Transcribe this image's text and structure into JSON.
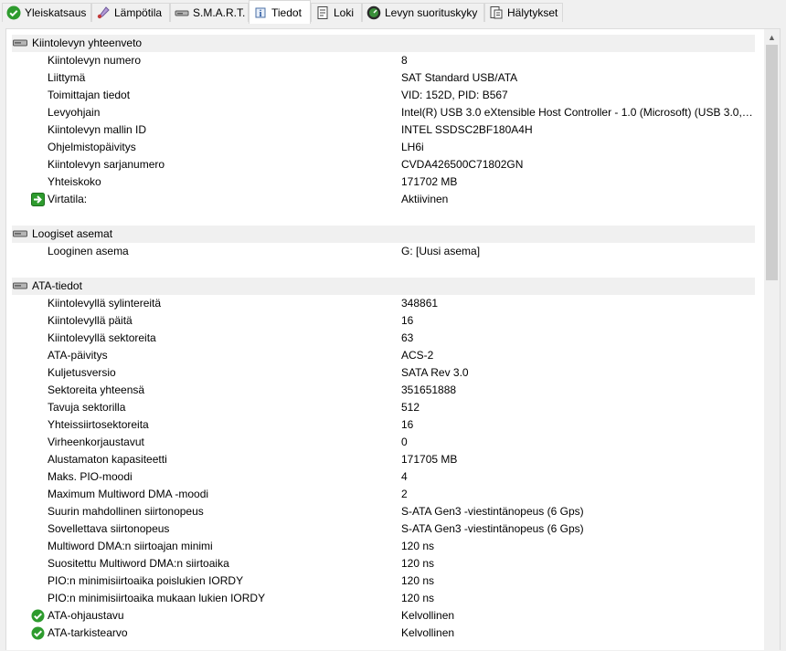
{
  "tabs": [
    {
      "label": "Yleiskatsaus",
      "icon": "check-circle-icon"
    },
    {
      "label": "Lämpötila",
      "icon": "thermometer-icon"
    },
    {
      "label": "S.M.A.R.T.",
      "icon": "disk-icon"
    },
    {
      "label": "Tiedot",
      "icon": "info-icon",
      "active": true
    },
    {
      "label": "Loki",
      "icon": "log-icon"
    },
    {
      "label": "Levyn suorituskyky",
      "icon": "gauge-icon"
    },
    {
      "label": "Hälytykset",
      "icon": "alerts-icon"
    }
  ],
  "sections": {
    "summary": {
      "title": "Kiintolevyn yhteenveto",
      "rows": [
        {
          "label": "Kiintolevyn numero",
          "value": "8"
        },
        {
          "label": "Liittymä",
          "value": "SAT Standard USB/ATA"
        },
        {
          "label": "Toimittajan tiedot",
          "value": "VID: 152D, PID: B567"
        },
        {
          "label": "Levyohjain",
          "value": "Intel(R) USB 3.0 eXtensible Host Controller - 1.0 (Microsoft) (USB 3.0, v..."
        },
        {
          "label": "Kiintolevyn mallin ID",
          "value": "INTEL SSDSC2BF180A4H"
        },
        {
          "label": "Ohjelmistopäivitys",
          "value": "LH6i"
        },
        {
          "label": "Kiintolevyn sarjanumero",
          "value": "CVDA426500C71802GN"
        },
        {
          "label": "Yhteiskoko",
          "value": "171702 MB"
        },
        {
          "label": "Virtatila:",
          "value": "Aktiivinen",
          "icon": "green-arrow-icon"
        }
      ]
    },
    "logical": {
      "title": "Loogiset asemat",
      "rows": [
        {
          "label": "Looginen asema",
          "value": "G: [Uusi asema]"
        }
      ]
    },
    "ata": {
      "title": "ATA-tiedot",
      "rows": [
        {
          "label": "Kiintolevyllä sylintereitä",
          "value": "348861"
        },
        {
          "label": "Kiintolevyllä päitä",
          "value": "16"
        },
        {
          "label": "Kiintolevyllä sektoreita",
          "value": "63"
        },
        {
          "label": "ATA-päivitys",
          "value": "ACS-2"
        },
        {
          "label": "Kuljetusversio",
          "value": "SATA Rev 3.0"
        },
        {
          "label": "Sektoreita yhteensä",
          "value": "351651888"
        },
        {
          "label": "Tavuja sektorilla",
          "value": "512"
        },
        {
          "label": "Yhteissiirtosektoreita",
          "value": "16"
        },
        {
          "label": "Virheenkorjaustavut",
          "value": "0"
        },
        {
          "label": "Alustamaton kapasiteetti",
          "value": "171705 MB"
        },
        {
          "label": "Maks. PIO-moodi",
          "value": "4"
        },
        {
          "label": "Maximum Multiword DMA -moodi",
          "value": "2"
        },
        {
          "label": "Suurin mahdollinen siirtonopeus",
          "value": "S-ATA Gen3 -viestintänopeus (6 Gps)"
        },
        {
          "label": "Sovellettava siirtonopeus",
          "value": "S-ATA Gen3 -viestintänopeus (6 Gps)"
        },
        {
          "label": "Multiword DMA:n siirtoajan minimi",
          "value": "120 ns"
        },
        {
          "label": "Suositettu Multiword DMA:n siirtoaika",
          "value": "120 ns"
        },
        {
          "label": "PIO:n minimisiirtoaika poislukien IORDY",
          "value": "120 ns"
        },
        {
          "label": "PIO:n minimisiirtoaika mukaan lukien IORDY",
          "value": "120 ns"
        },
        {
          "label": "ATA-ohjaustavu",
          "value": "Kelvollinen",
          "icon": "green-check-icon"
        },
        {
          "label": "ATA-tarkistearvo",
          "value": "Kelvollinen",
          "icon": "green-check-icon"
        }
      ]
    }
  },
  "colors": {
    "ok_green": "#2e9b2e",
    "section_bg": "#f0f0f0",
    "scroll_thumb": "#cdcdcd"
  }
}
